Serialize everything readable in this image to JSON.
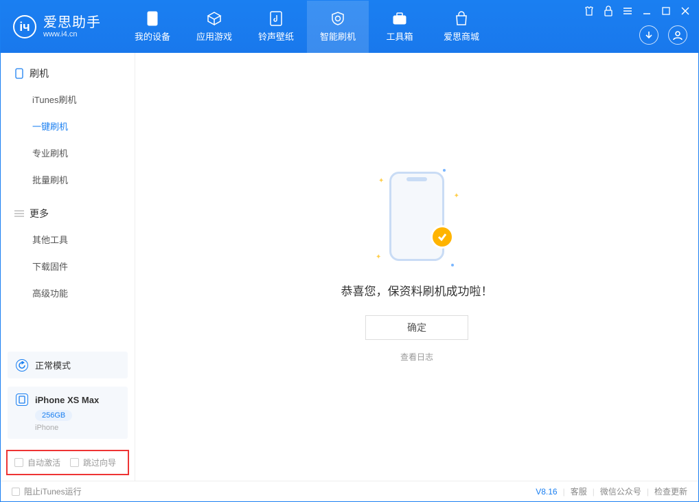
{
  "app": {
    "name_cn": "爱思助手",
    "name_en": "www.i4.cn"
  },
  "nav": {
    "device": "我的设备",
    "apps": "应用游戏",
    "ring": "铃声壁纸",
    "flash": "智能刷机",
    "toolbox": "工具箱",
    "store": "爱思商城"
  },
  "sidebar": {
    "flash_header": "刷机",
    "items": {
      "itunes": "iTunes刷机",
      "oneclick": "一键刷机",
      "pro": "专业刷机",
      "batch": "批量刷机"
    },
    "more_header": "更多",
    "more_items": {
      "other": "其他工具",
      "firmware": "下载固件",
      "advanced": "高级功能"
    },
    "mode_card": "正常模式",
    "device": {
      "name": "iPhone XS Max",
      "storage": "256GB",
      "type": "iPhone"
    },
    "bottom": {
      "auto_activate": "自动激活",
      "skip_guide": "跳过向导"
    }
  },
  "content": {
    "message": "恭喜您，保资料刷机成功啦！",
    "ok": "确定",
    "view_log": "查看日志"
  },
  "status": {
    "block_itunes": "阻止iTunes运行",
    "version": "V8.16",
    "support": "客服",
    "wechat": "微信公众号",
    "update": "检查更新"
  }
}
